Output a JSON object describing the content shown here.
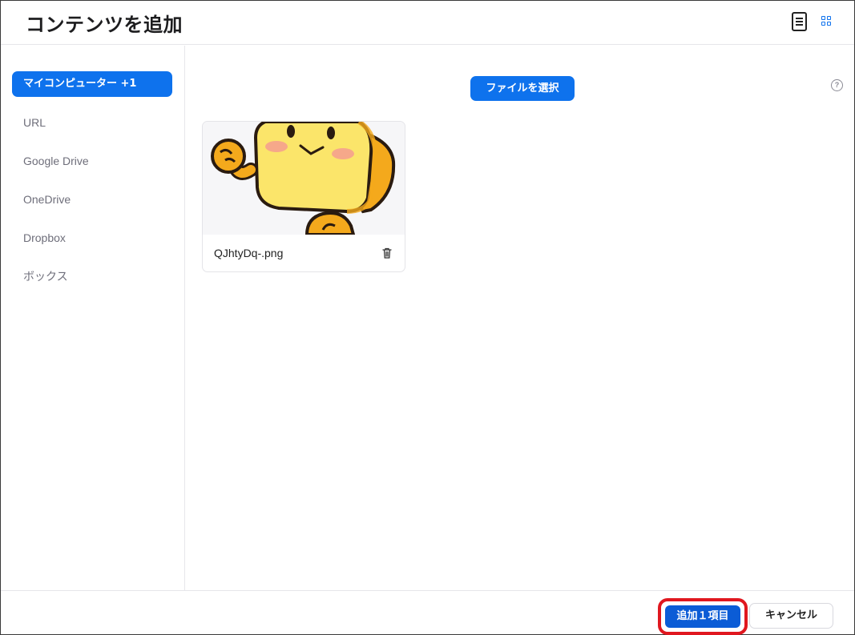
{
  "header": {
    "title": "コンテンツを追加",
    "list_view_icon": "list-view-icon",
    "grid_view_icon": "grid-view-icon",
    "accent_color": "#0e72ed"
  },
  "sidebar": {
    "items": [
      {
        "label": "マイコンピューター +1",
        "active": true
      },
      {
        "label": "URL",
        "active": false
      },
      {
        "label": "Google Drive",
        "active": false
      },
      {
        "label": "OneDrive",
        "active": false
      },
      {
        "label": "Dropbox",
        "active": false
      },
      {
        "label": "ボックス",
        "active": false
      }
    ]
  },
  "main": {
    "choose_file_label": "ファイルを選択",
    "help_icon_glyph": "?",
    "files": [
      {
        "name": "QJhtyDq-.png",
        "icon": "trash-icon"
      }
    ]
  },
  "footer": {
    "add_label": "追加１項目",
    "cancel_label": "キャンセル",
    "highlight_color": "#e0171f"
  }
}
